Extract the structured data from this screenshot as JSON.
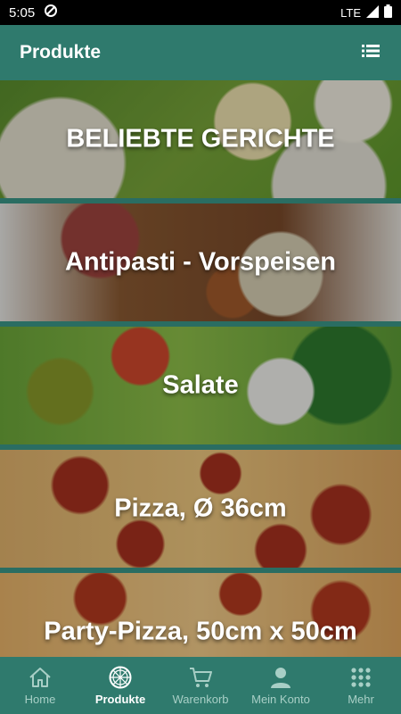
{
  "status_bar": {
    "time": "5:05",
    "network": "LTE"
  },
  "app_bar": {
    "title": "Produkte",
    "list_icon": "list-icon"
  },
  "categories": [
    {
      "label": "BELIEBTE GERICHTE"
    },
    {
      "label": "Antipasti - Vorspeisen"
    },
    {
      "label": "Salate"
    },
    {
      "label": "Pizza, Ø 36cm"
    },
    {
      "label": "Party-Pizza, 50cm x 50cm"
    }
  ],
  "bottom_nav": {
    "items": [
      {
        "label": "Home",
        "icon": "home-icon"
      },
      {
        "label": "Produkte",
        "icon": "pizza-icon",
        "active": true
      },
      {
        "label": "Warenkorb",
        "icon": "cart-icon"
      },
      {
        "label": "Mein Konto",
        "icon": "person-icon"
      },
      {
        "label": "Mehr",
        "icon": "grid-icon"
      }
    ]
  },
  "colors": {
    "primary": "#2f7a6d",
    "nav_inactive": "#a8cfc6",
    "nav_active": "#ffffff"
  }
}
